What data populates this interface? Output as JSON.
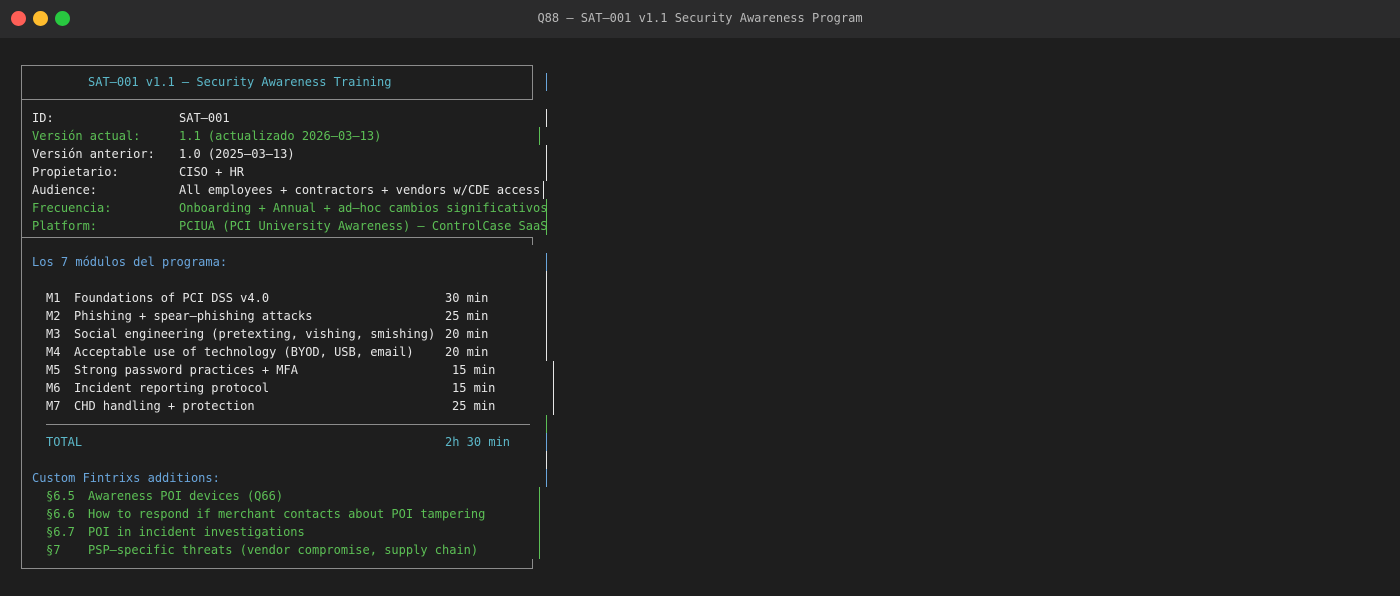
{
  "window": {
    "title": "Q88 — SAT–001 v1.1 Security Awareness Program"
  },
  "header": {
    "title": "SAT–001 v1.1 — Security Awareness Training"
  },
  "meta": [
    {
      "label": "ID:",
      "value": "SAT–001",
      "color": "white"
    },
    {
      "label": "Versión actual:",
      "value": "1.1 (actualizado 2026–03–13)",
      "color": "green"
    },
    {
      "label": "Versión anterior:",
      "value": "1.0 (2025–03–13)",
      "color": "white"
    },
    {
      "label": "Propietario:",
      "value": "CISO + HR",
      "color": "white"
    },
    {
      "label": "Audience:",
      "value": "All employees + contractors + vendors w/CDE access",
      "color": "white"
    },
    {
      "label": "Frecuencia:",
      "value": "Onboarding + Annual + ad–hoc cambios significativos",
      "color": "green"
    },
    {
      "label": "Platform:",
      "value": "PCIUA (PCI University Awareness) — ControlCase SaaS",
      "color": "green"
    }
  ],
  "modules": {
    "heading": "Los 7 módulos del programa:",
    "items": [
      {
        "id": "M1",
        "name": "Foundations of PCI DSS v4.0",
        "duration": "30 min"
      },
      {
        "id": "M2",
        "name": "Phishing + spear–phishing attacks",
        "duration": "25 min"
      },
      {
        "id": "M3",
        "name": "Social engineering (pretexting, vishing, smishing)",
        "duration": "20 min"
      },
      {
        "id": "M4",
        "name": "Acceptable use of technology (BYOD, USB, email)",
        "duration": "20 min"
      },
      {
        "id": "M5",
        "name": "Strong password practices + MFA",
        "duration": "15 min"
      },
      {
        "id": "M6",
        "name": "Incident reporting protocol",
        "duration": "15 min"
      },
      {
        "id": "M7",
        "name": "CHD handling + protection",
        "duration": "25 min"
      }
    ],
    "total_label": "TOTAL",
    "total_value": "2h 30 min"
  },
  "custom": {
    "heading": "Custom Fintrixs additions:",
    "items": [
      {
        "ref": "§6.5",
        "text": "Awareness POI devices (Q66)"
      },
      {
        "ref": "§6.6",
        "text": "How to respond if merchant contacts about POI tampering"
      },
      {
        "ref": "§6.7",
        "text": "POI in incident investigations"
      },
      {
        "ref": "§7",
        "text": "PSP–specific threats (vendor compromise, supply chain)"
      }
    ]
  },
  "colors": {
    "background": "#1e1e1e",
    "titlebar": "#2b2b2c",
    "text": "#e6e6e6",
    "green": "#5cbf55",
    "cyan": "#5cb8c9",
    "blue": "#6aa6dc",
    "border": "#8c8c8c"
  }
}
